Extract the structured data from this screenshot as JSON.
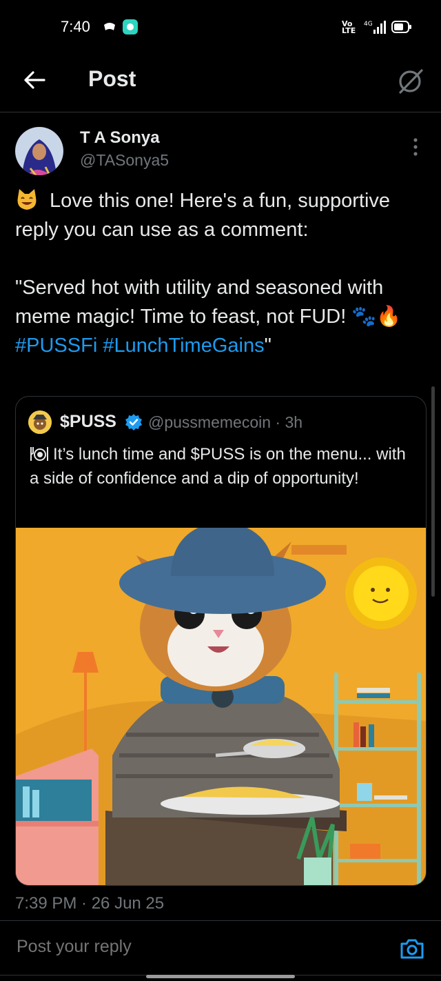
{
  "status_bar": {
    "time": "7:40",
    "volte": "Vo\nLTE",
    "network": "4G"
  },
  "header": {
    "title": "Post"
  },
  "author": {
    "name": "T A Sonya",
    "handle": "@TASonya5"
  },
  "tweet": {
    "line1": " Love this one! Here's a fun, supportive reply you can use as a comment:",
    "quote_text": "\"Served hot with utility and seasoned with meme magic! Time to feast, not FUD! 🐾🔥 ",
    "hashtags": "#PUSSFi #LunchTimeGains",
    "close_quote": "\""
  },
  "quoted": {
    "name": "$PUSS",
    "handle": "@pussmemecoin · 3h",
    "text": "It’s lunch time and $PUSS is on the menu... with a side of confidence and a dip of opportunity!"
  },
  "timestamp": "7:39 PM · 26 Jun 25",
  "reply": {
    "placeholder": "Post your reply"
  },
  "colors": {
    "accent": "#1d9bf0",
    "bg": "#000000",
    "muted": "#71767b",
    "image_bg": "#f0a92a"
  },
  "icons": [
    "back-arrow-icon",
    "grok-icon",
    "more-vertical-icon",
    "verified-badge-icon",
    "camera-icon"
  ]
}
